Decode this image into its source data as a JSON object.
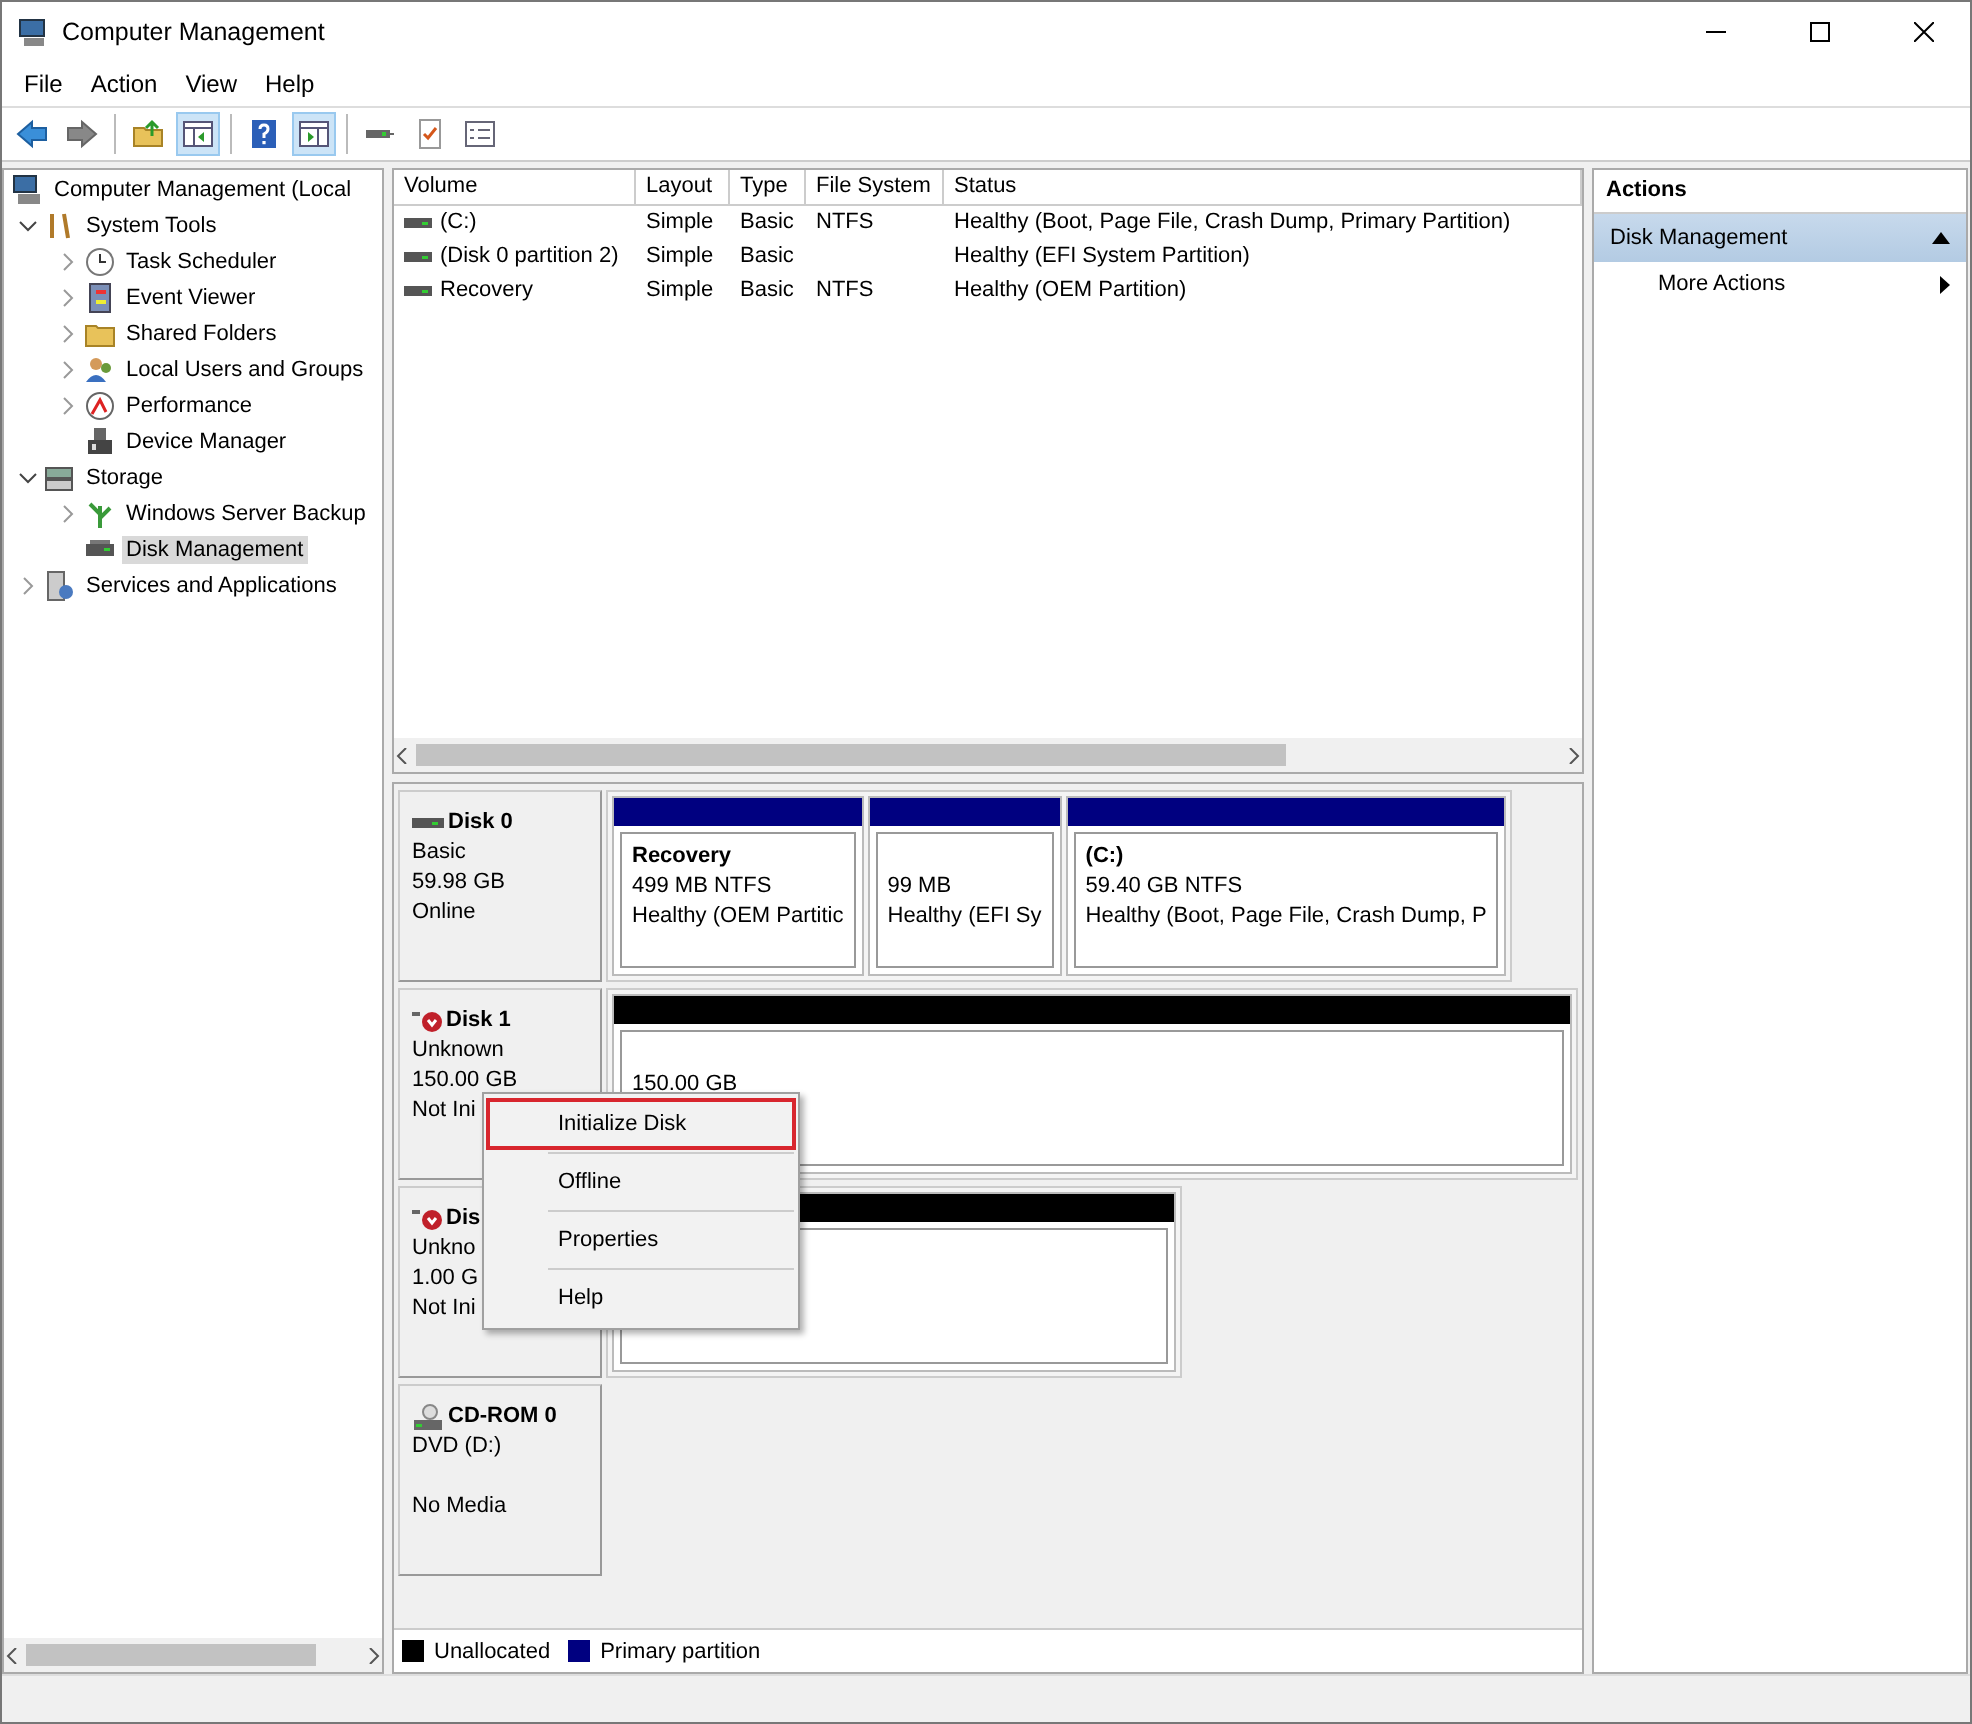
{
  "window": {
    "title": "Computer Management"
  },
  "menu": [
    "File",
    "Action",
    "View",
    "Help"
  ],
  "toolbar": [
    {
      "pressed": false
    },
    {
      "pressed": false
    },
    {
      "pressed": false
    },
    {
      "pressed": true
    },
    {
      "pressed": false
    },
    {
      "pressed": true
    },
    {
      "pressed": false
    },
    {
      "pressed": false
    },
    {
      "pressed": false
    }
  ],
  "tree": [
    {
      "label": "Computer Management (Local",
      "selected": false,
      "children": [
        {
          "label": "System Tools",
          "expanded": true,
          "selected": false,
          "children": [
            {
              "label": "Task Scheduler",
              "expanded": false,
              "selected": false
            },
            {
              "label": "Event Viewer",
              "expanded": false,
              "selected": false
            },
            {
              "label": "Shared Folders",
              "expanded": false,
              "selected": false
            },
            {
              "label": "Local Users and Groups",
              "expanded": false,
              "selected": false
            },
            {
              "label": "Performance",
              "expanded": false,
              "selected": false
            },
            {
              "label": "Device Manager",
              "selected": false
            }
          ]
        },
        {
          "label": "Storage",
          "expanded": true,
          "selected": false,
          "children": [
            {
              "label": "Windows Server Backup",
              "expanded": false,
              "selected": false
            },
            {
              "label": "Disk Management",
              "selected": true
            }
          ]
        },
        {
          "label": "Services and Applications",
          "expanded": false,
          "selected": false
        }
      ]
    }
  ],
  "volumes": {
    "columns": [
      "Volume",
      "Layout",
      "Type",
      "File System",
      "Status"
    ],
    "rows": [
      [
        "(C:)",
        "Simple",
        "Basic",
        "NTFS",
        "Healthy (Boot, Page File, Crash Dump, Primary Partition)"
      ],
      [
        "(Disk 0 partition 2)",
        "Simple",
        "Basic",
        "",
        "Healthy (EFI System Partition)"
      ],
      [
        "Recovery",
        "Simple",
        "Basic",
        "NTFS",
        "Healthy (OEM Partition)"
      ]
    ]
  },
  "disks": [
    {
      "kind": "disk",
      "error": false,
      "name": "Disk 0",
      "lines": [
        "Basic",
        "59.98 GB",
        "Online"
      ],
      "partitions": [
        {
          "kind": "primary",
          "name": "Recovery",
          "size": "499 MB NTFS",
          "status": "Healthy (OEM Partitic"
        },
        {
          "kind": "primary",
          "size": "99 MB",
          "status": "Healthy (EFI Sy"
        },
        {
          "kind": "primary",
          "name": "(C:)",
          "size": "59.40 GB NTFS",
          "status": "Healthy (Boot, Page File, Crash Dump, P"
        }
      ]
    },
    {
      "kind": "disk",
      "error": true,
      "name": "Disk 1",
      "lines": [
        "Unknown",
        "150.00 GB",
        "Not Ini"
      ],
      "partitions": [
        {
          "kind": "unallocated",
          "size": "150.00 GB"
        }
      ]
    },
    {
      "kind": "disk",
      "error": true,
      "name": "Dis",
      "lines": [
        "Unkno",
        "1.00 G",
        "Not Ini"
      ],
      "partitions": [
        {
          "kind": "unallocated"
        }
      ]
    },
    {
      "kind": "cdrom",
      "name": "CD-ROM 0",
      "lines": [
        "DVD (D:)",
        "No Media"
      ]
    }
  ],
  "legend": [
    {
      "label": "Unallocated",
      "color": "#000000"
    },
    {
      "label": "Primary partition",
      "color": "#000080"
    }
  ],
  "context_menu": [
    {
      "label": "Initialize Disk",
      "selected": true
    },
    {
      "label": "Offline",
      "selected": false
    },
    {
      "label": "Properties",
      "selected": false
    },
    {
      "label": "Help",
      "selected": false
    }
  ],
  "actions": {
    "title": "Actions",
    "section": "Disk Management",
    "items": [
      "More Actions"
    ]
  }
}
